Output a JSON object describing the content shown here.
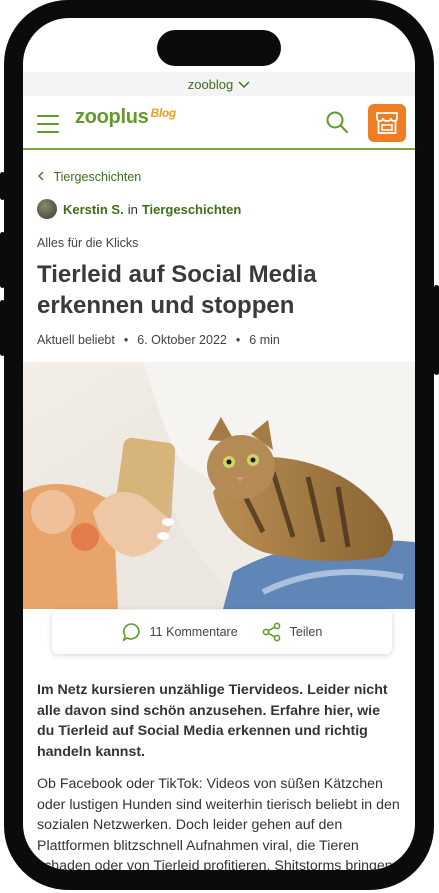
{
  "topbar": {
    "label": "zooblog"
  },
  "header": {
    "brand": "zooplus",
    "brand_sub": "Blog"
  },
  "breadcrumb": {
    "label": "Tiergeschichten"
  },
  "author": {
    "name": "Kerstin S.",
    "connector": "in",
    "category": "Tiergeschichten"
  },
  "article": {
    "kicker": "Alles für die Klicks",
    "title": "Tierleid auf Social Media erkennen und stoppen",
    "meta": {
      "tag": "Aktuell beliebt",
      "date": "6. Oktober 2022",
      "read_time": "6 min"
    },
    "image_credit": "©",
    "comments_label": "11 Kommentare",
    "share_label": "Teilen",
    "lead": "Im Netz kursieren unzählige Tiervideos. Leider nicht alle davon sind schön anzusehen. Erfahre hier, wie du Tierleid auf Social Media erkennen und richtig handeln kannst.",
    "body": "Ob Facebook oder TikTok: Videos von süßen Kätzchen oder lustigen Hunden sind weiterhin tierisch beliebt in den sozialen Netzwerken. Doch leider gehen auf den Plattformen blitzschnell Aufnahmen viral, die Tieren schaden oder von Tierleid profitieren. Shitstorms bringen"
  },
  "icons": {
    "menu": "hamburger-icon",
    "search": "search-icon",
    "shop": "shop-icon",
    "comment": "comment-icon",
    "share": "share-icon",
    "back": "chevron-left-icon",
    "dropdown": "chevron-down-icon"
  },
  "colors": {
    "brand_green": "#5f9a2a",
    "accent_orange": "#ef7d23",
    "text": "#333333"
  }
}
